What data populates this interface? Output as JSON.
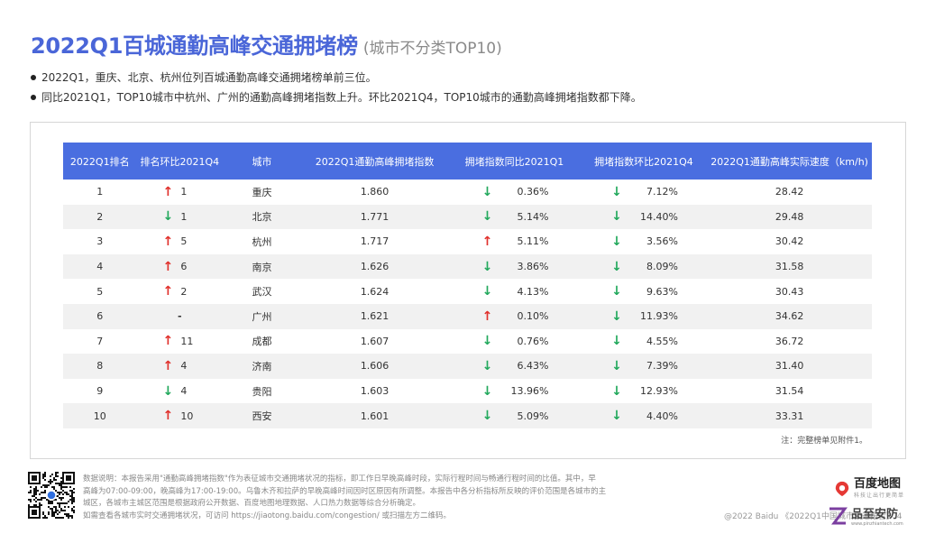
{
  "header": {
    "title": "2022Q1百城通勤高峰交通拥堵榜",
    "subtitle": "(城市不分类TOP10)"
  },
  "bullets": [
    "2022Q1，重庆、北京、杭州位列百城通勤高峰交通拥堵榜单前三位。",
    "同比2021Q1，TOP10城市中杭州、广州的通勤高峰拥堵指数上升。环比2021Q4，TOP10城市的通勤高峰拥堵指数都下降。"
  ],
  "table": {
    "columns": [
      "2022Q1排名",
      "排名环比2021Q4",
      "城市",
      "2022Q1通勤高峰拥堵指数",
      "拥堵指数同比2021Q1",
      "拥堵指数环比2021Q4",
      "2022Q1通勤高峰实际速度（km/h)"
    ],
    "rows": [
      {
        "rank": "1",
        "rank_dir": "up",
        "rank_change": "1",
        "city": "重庆",
        "index": "1.860",
        "yoy_dir": "down",
        "yoy": "0.36%",
        "qoq_dir": "down",
        "qoq": "7.12%",
        "speed": "28.42"
      },
      {
        "rank": "2",
        "rank_dir": "down",
        "rank_change": "1",
        "city": "北京",
        "index": "1.771",
        "yoy_dir": "down",
        "yoy": "5.14%",
        "qoq_dir": "down",
        "qoq": "14.40%",
        "speed": "29.48"
      },
      {
        "rank": "3",
        "rank_dir": "up",
        "rank_change": "5",
        "city": "杭州",
        "index": "1.717",
        "yoy_dir": "up",
        "yoy": "5.11%",
        "qoq_dir": "down",
        "qoq": "3.56%",
        "speed": "30.42"
      },
      {
        "rank": "4",
        "rank_dir": "up",
        "rank_change": "6",
        "city": "南京",
        "index": "1.626",
        "yoy_dir": "down",
        "yoy": "3.86%",
        "qoq_dir": "down",
        "qoq": "8.09%",
        "speed": "31.58"
      },
      {
        "rank": "5",
        "rank_dir": "up",
        "rank_change": "2",
        "city": "武汉",
        "index": "1.624",
        "yoy_dir": "down",
        "yoy": "4.13%",
        "qoq_dir": "down",
        "qoq": "9.63%",
        "speed": "30.43"
      },
      {
        "rank": "6",
        "rank_dir": "none",
        "rank_change": "-",
        "city": "广州",
        "index": "1.621",
        "yoy_dir": "up",
        "yoy": "0.10%",
        "qoq_dir": "down",
        "qoq": "11.93%",
        "speed": "34.62"
      },
      {
        "rank": "7",
        "rank_dir": "up",
        "rank_change": "11",
        "city": "成都",
        "index": "1.607",
        "yoy_dir": "down",
        "yoy": "0.76%",
        "qoq_dir": "down",
        "qoq": "4.55%",
        "speed": "36.72"
      },
      {
        "rank": "8",
        "rank_dir": "up",
        "rank_change": "4",
        "city": "济南",
        "index": "1.606",
        "yoy_dir": "down",
        "yoy": "6.43%",
        "qoq_dir": "down",
        "qoq": "7.39%",
        "speed": "31.40"
      },
      {
        "rank": "9",
        "rank_dir": "down",
        "rank_change": "4",
        "city": "贵阳",
        "index": "1.603",
        "yoy_dir": "down",
        "yoy": "13.96%",
        "qoq_dir": "down",
        "qoq": "12.93%",
        "speed": "31.54"
      },
      {
        "rank": "10",
        "rank_dir": "up",
        "rank_change": "10",
        "city": "西安",
        "index": "1.601",
        "yoy_dir": "down",
        "yoy": "5.09%",
        "qoq_dir": "down",
        "qoq": "4.40%",
        "speed": "33.31"
      }
    ],
    "note": "注：完整榜单见附件1。"
  },
  "footer": {
    "lines": [
      "数据说明：本报告采用\"通勤高峰拥堵指数\"作为表征城市交通拥堵状况的指标，即工作日早晚高峰时段，实际行程时间与畅通行程时间的比值。其中，早",
      "高峰为07:00-09:00，晚高峰为17:00-19:00。乌鲁木齐和拉萨的早晚高峰时间因时区原因有所调整。本报告中各分析指标所反映的评价范围是各城市的主",
      "城区，各城市主城区范围是根据政府公开数据、百度地图地理数据、人口热力数据等综合分析确定。",
      "如需查看各城市实时交通拥堵状况，可访问 https://jiaotong.baidu.com/congestion/ 或扫描左方二维码。"
    ],
    "copyright": "@2022 Baidu 《2022Q1中国城市交通报告》 4",
    "logo_text": "百度地图",
    "logo_sub": "科技让出行更简单",
    "watermark_text": "品至安防",
    "watermark_sub": "www.pinzhiantech.com"
  },
  "colors": {
    "accent": "#4a66d8",
    "header_bg": "#4a6ee0",
    "up": "#e0302b",
    "down": "#20a85b"
  },
  "icons": {
    "up": "up-arrow-icon",
    "down": "down-arrow-icon",
    "qr": "qr-code-icon",
    "logo": "baidu-map-pin-icon"
  }
}
